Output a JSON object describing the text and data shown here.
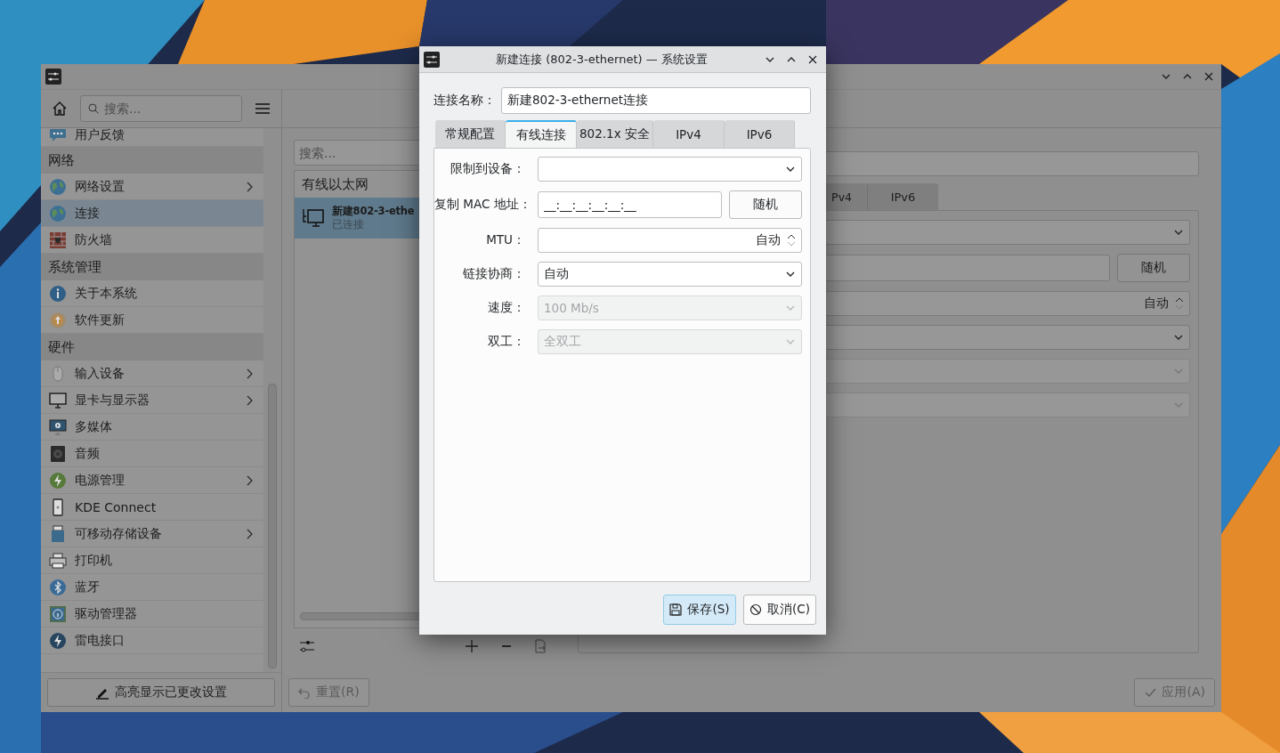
{
  "main_window": {
    "sidebar": {
      "search": {
        "placeholder": "搜索..."
      },
      "items": [
        {
          "kind": "item",
          "label": "用户反馈",
          "expandable": false,
          "selected": false
        },
        {
          "kind": "section",
          "label": "网络"
        },
        {
          "kind": "item",
          "label": "网络设置",
          "expandable": true,
          "selected": false
        },
        {
          "kind": "item",
          "label": "连接",
          "expandable": false,
          "selected": true
        },
        {
          "kind": "item",
          "label": "防火墙",
          "expandable": false,
          "selected": false
        },
        {
          "kind": "section",
          "label": "系统管理"
        },
        {
          "kind": "item",
          "label": "关于本系统",
          "expandable": false,
          "selected": false
        },
        {
          "kind": "item",
          "label": "软件更新",
          "expandable": false,
          "selected": false
        },
        {
          "kind": "section",
          "label": "硬件"
        },
        {
          "kind": "item",
          "label": "输入设备",
          "expandable": true,
          "selected": false
        },
        {
          "kind": "item",
          "label": "显卡与显示器",
          "expandable": true,
          "selected": false
        },
        {
          "kind": "item",
          "label": "多媒体",
          "expandable": false,
          "selected": false
        },
        {
          "kind": "item",
          "label": "音频",
          "expandable": false,
          "selected": false
        },
        {
          "kind": "item",
          "label": "电源管理",
          "expandable": true,
          "selected": false
        },
        {
          "kind": "item",
          "label": "KDE Connect",
          "expandable": false,
          "selected": false
        },
        {
          "kind": "item",
          "label": "可移动存储设备",
          "expandable": true,
          "selected": false
        },
        {
          "kind": "item",
          "label": "打印机",
          "expandable": false,
          "selected": false
        },
        {
          "kind": "item",
          "label": "蓝牙",
          "expandable": false,
          "selected": false
        },
        {
          "kind": "item",
          "label": "驱动管理器",
          "expandable": false,
          "selected": false
        },
        {
          "kind": "item",
          "label": "雷电接口",
          "expandable": false,
          "selected": false
        }
      ],
      "highlight_button": "高亮显示已更改设置"
    },
    "connections": {
      "search": {
        "placeholder": "搜索..."
      },
      "group": "有线以太网",
      "items": [
        {
          "name": "新建802-3-ethe",
          "status": "已连接",
          "selected": true
        }
      ],
      "reset_button": {
        "label": "重置(R)",
        "disabled": true
      }
    },
    "editor": {
      "tabs": [
        {
          "label": "Pv4",
          "selected": false
        },
        {
          "label": "IPv6",
          "selected": false
        }
      ],
      "random_button": "随机",
      "mtu_value": "自动",
      "apply_button": {
        "label": "应用(A)",
        "disabled": true
      }
    }
  },
  "dialog": {
    "title": "新建连接 (802-3-ethernet) — 系统设置",
    "name_label": "连接名称：",
    "name_value": "新建802-3-ethernet连接",
    "tabs": [
      {
        "label": "常规配置",
        "selected": false
      },
      {
        "label": "有线连接",
        "selected": true
      },
      {
        "label": "802.1x 安全",
        "selected": false
      },
      {
        "label": "IPv4",
        "selected": false
      },
      {
        "label": "IPv6",
        "selected": false
      }
    ],
    "fields": [
      {
        "kind": "combo",
        "label": "限制到设备：",
        "disabled": false
      },
      {
        "kind": "mac",
        "label": "复制 MAC 地址：",
        "value": "__:__:__:__:__:__",
        "button": "随机"
      },
      {
        "kind": "spin",
        "label": "MTU：",
        "value": "自动"
      },
      {
        "kind": "combo",
        "label": "链接协商：",
        "value": "自动",
        "disabled": false
      },
      {
        "kind": "combo",
        "label": "速度：",
        "value": "100 Mb/s",
        "disabled": true
      },
      {
        "kind": "combo",
        "label": "双工：",
        "value": "全双工",
        "disabled": true
      }
    ],
    "buttons": [
      {
        "kind": "save",
        "label": "保存(S)",
        "default": true
      },
      {
        "kind": "cancel",
        "label": "取消(C)",
        "default": false
      }
    ]
  }
}
